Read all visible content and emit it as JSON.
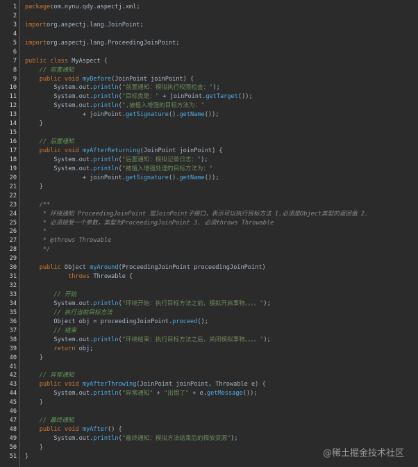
{
  "editor": {
    "lines": [
      [
        [
          "kw",
          "package"
        ],
        [
          "",
          "com.nynu.qdy.aspectj.xml;"
        ]
      ],
      [],
      [
        [
          "kw",
          "import"
        ],
        [
          "",
          "org.aspectj.lang.JoinPoint;"
        ]
      ],
      [],
      [
        [
          "kw",
          "import"
        ],
        [
          "",
          "org.aspectj.lang.ProceedingJoinPoint;"
        ]
      ],
      [],
      [
        [
          "kw",
          "public class"
        ],
        [
          "",
          " MyAspect {"
        ]
      ],
      [
        [
          "cm",
          "    // 前置通知"
        ]
      ],
      [
        [
          "kw",
          "    public void "
        ],
        [
          "fn",
          "myBefore"
        ],
        [
          "",
          "(JoinPoint joinPoint) {"
        ]
      ],
      [
        [
          "",
          "        System.out."
        ],
        [
          "fn",
          "println"
        ],
        [
          "",
          "("
        ],
        [
          "str",
          "\"前置通知：模拟执行权限检查：\""
        ],
        [
          "",
          ");"
        ]
      ],
      [
        [
          "",
          "        System.out."
        ],
        [
          "fn",
          "println"
        ],
        [
          "",
          "("
        ],
        [
          "str",
          "\"目标类是：\""
        ],
        [
          "",
          " + joinPoint."
        ],
        [
          "fn",
          "getTarget"
        ],
        [
          "",
          "());"
        ]
      ],
      [
        [
          "",
          "        System.out."
        ],
        [
          "fn",
          "println"
        ],
        [
          "",
          "("
        ],
        [
          "str",
          "\",被植入增强的目标方法为：\""
        ]
      ],
      [
        [
          "",
          "                + joinPoint."
        ],
        [
          "fn",
          "getSignature"
        ],
        [
          "",
          "()."
        ],
        [
          "fn",
          "getName"
        ],
        [
          "",
          "());"
        ]
      ],
      [
        [
          "",
          "    }"
        ]
      ],
      [],
      [
        [
          "cm",
          "    // 后置通知"
        ]
      ],
      [
        [
          "kw",
          "    public void "
        ],
        [
          "fn",
          "myAfterReturning"
        ],
        [
          "",
          "(JoinPoint joinPoint) {"
        ]
      ],
      [
        [
          "",
          "        System.out."
        ],
        [
          "fn",
          "println"
        ],
        [
          "",
          "("
        ],
        [
          "str",
          "\"后置通知：模拟记录日志：\""
        ],
        [
          "",
          ");"
        ]
      ],
      [
        [
          "",
          "        System.out."
        ],
        [
          "fn",
          "println"
        ],
        [
          "",
          "("
        ],
        [
          "str",
          "\"被植入增强处理的目标方法为：\""
        ]
      ],
      [
        [
          "",
          "                + joinPoint."
        ],
        [
          "fn",
          "getSignature"
        ],
        [
          "",
          "()."
        ],
        [
          "fn",
          "getName"
        ],
        [
          "",
          "());"
        ]
      ],
      [
        [
          "",
          "    }"
        ]
      ],
      [],
      [
        [
          "doc",
          "    /**"
        ]
      ],
      [
        [
          "doc",
          "     * 环绕通知 ProceedingJoinPoint 是JoinPoint子接口，表示可以执行目标方法 1.必须是Object类型的返回值 2."
        ]
      ],
      [
        [
          "doc",
          "     * 必须接受一个参数，类型为ProceedingJoinPoint 3. 必须throws Throwable"
        ]
      ],
      [
        [
          "doc",
          "     *"
        ]
      ],
      [
        [
          "doc",
          "     * @throws Throwable"
        ]
      ],
      [
        [
          "doc",
          "     */"
        ]
      ],
      [],
      [
        [
          "kw",
          "    public "
        ],
        [
          "",
          "Object "
        ],
        [
          "fn",
          "myAround"
        ],
        [
          "",
          "(ProceedingJoinPoint proceedingJoinPoint)"
        ]
      ],
      [
        [
          "kw",
          "            throws "
        ],
        [
          "",
          "Throwable {"
        ]
      ],
      [],
      [
        [
          "cm",
          "        // 开始"
        ]
      ],
      [
        [
          "",
          "        System.out."
        ],
        [
          "fn",
          "println"
        ],
        [
          "",
          "("
        ],
        [
          "str",
          "\"环绕开始：执行目标方法之前，模拟开启事物。。。。\""
        ],
        [
          "",
          ");"
        ]
      ],
      [
        [
          "cm",
          "        // 执行当前目标方法"
        ]
      ],
      [
        [
          "",
          "        Object obj = proceedingJoinPoint."
        ],
        [
          "fn",
          "proceed"
        ],
        [
          "",
          "();"
        ]
      ],
      [
        [
          "cm",
          "        // 结束"
        ]
      ],
      [
        [
          "",
          "        System.out."
        ],
        [
          "fn",
          "println"
        ],
        [
          "",
          "("
        ],
        [
          "str",
          "\"环绕结束：执行目标方法之后，关闭模拟事物。。。。\""
        ],
        [
          "",
          ");"
        ]
      ],
      [
        [
          "kw",
          "        return "
        ],
        [
          "",
          "obj;"
        ]
      ],
      [
        [
          "",
          "    }"
        ]
      ],
      [],
      [
        [
          "cm",
          "    // 异常通知"
        ]
      ],
      [
        [
          "kw",
          "    public void "
        ],
        [
          "fn",
          "myAfterThrowing"
        ],
        [
          "",
          "(JoinPoint joinPoint, Throwable e) {"
        ]
      ],
      [
        [
          "",
          "        System.out."
        ],
        [
          "fn",
          "println"
        ],
        [
          "",
          "("
        ],
        [
          "str",
          "\"异常通知\""
        ],
        [
          "",
          " + "
        ],
        [
          "str",
          "\"出错了\""
        ],
        [
          "",
          " + e."
        ],
        [
          "fn",
          "getMessage"
        ],
        [
          "",
          "());"
        ]
      ],
      [
        [
          "",
          "    }"
        ]
      ],
      [],
      [
        [
          "cm",
          "    // 最终通知"
        ]
      ],
      [
        [
          "kw",
          "    public void "
        ],
        [
          "fn",
          "myAfter"
        ],
        [
          "",
          "() {"
        ]
      ],
      [
        [
          "",
          "        System.out."
        ],
        [
          "fn",
          "println"
        ],
        [
          "",
          "("
        ],
        [
          "str",
          "\"最终通知：模拟方法结束后的释放资源\""
        ],
        [
          "",
          ");"
        ]
      ],
      [
        [
          "",
          "    }"
        ]
      ],
      [
        [
          "",
          "}"
        ]
      ]
    ]
  },
  "watermark": "@稀土掘金技术社区"
}
